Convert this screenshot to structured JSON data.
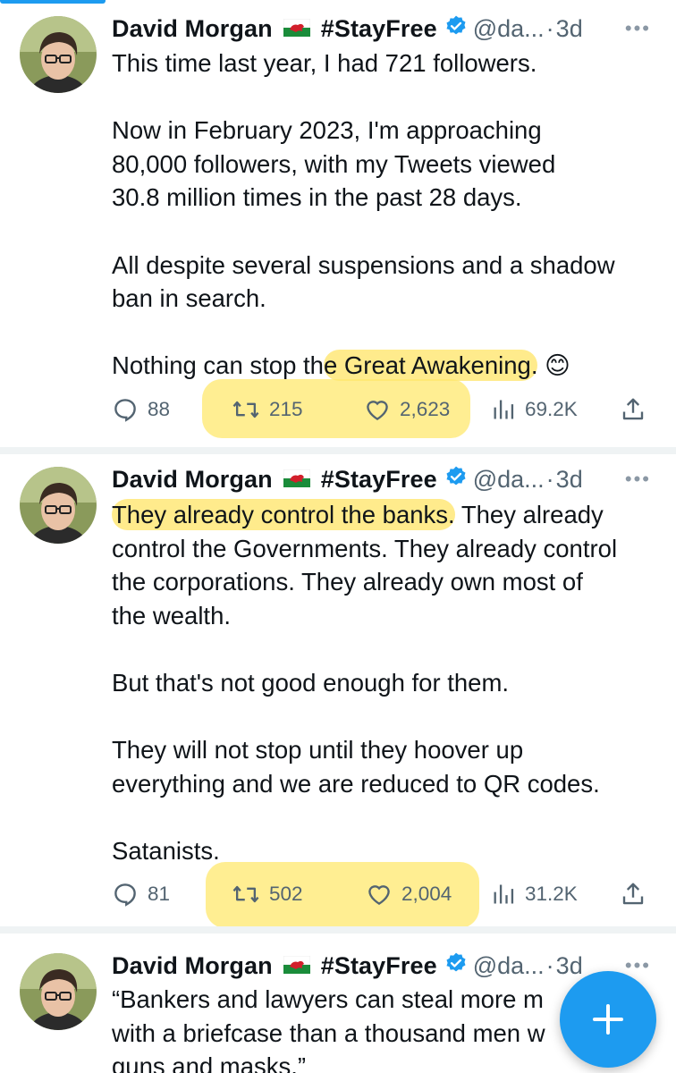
{
  "tweets": [
    {
      "name": "David Morgan",
      "hashtag": "#StayFree",
      "handle": "@da...",
      "time": "3d",
      "more": "•••",
      "lines": [
        "This time last year, I had 721 followers.",
        "",
        "Now in February 2023, I'm approaching",
        "80,000 followers, with my Tweets viewed",
        "30.8 million times in the past 28 days.",
        "",
        "All despite several suspensions and a shadow",
        "ban in search.",
        ""
      ],
      "last_line_pre": "Nothing can stop th",
      "last_line_hl": "e Great Awakening.",
      "last_line_emoji": "😊",
      "replies": "88",
      "retweets": "215",
      "likes": "2,623",
      "views": "69.2K"
    },
    {
      "name": "David Morgan",
      "hashtag": "#StayFree",
      "handle": "@da...",
      "time": "3d",
      "more": "•••",
      "first_line_hl": "They already control the banks.",
      "first_line_rest": " They already",
      "lines": [
        "control the Governments. They already control",
        "the corporations. They already own most of",
        "the wealth.",
        "",
        "But that's not good enough for them.",
        "",
        "They will not stop until they hoover up",
        "everything and we are reduced to QR codes.",
        "",
        "Satanists."
      ],
      "replies": "81",
      "retweets": "502",
      "likes": "2,004",
      "views": "31.2K"
    },
    {
      "name": "David Morgan",
      "hashtag": "#StayFree",
      "handle": "@da...",
      "time": "3d",
      "more": "•••",
      "lines": [
        "“Bankers and lawyers can steal more m",
        "with a briefcase than a thousand men w",
        "guns and masks.”"
      ]
    }
  ],
  "fab_icon": "plus-icon",
  "colors": {
    "accent": "#1d9bf0",
    "muted": "#536471",
    "highlight": "#ffe878"
  }
}
